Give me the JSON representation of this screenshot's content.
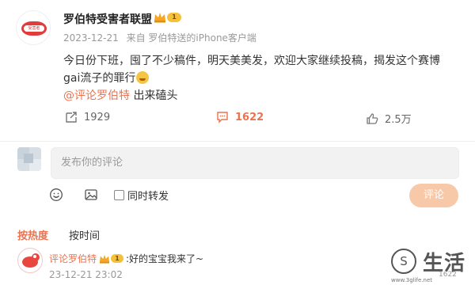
{
  "post": {
    "author": "罗伯特受害者联盟",
    "vip_level": "1",
    "avatar_text": "受害者",
    "time": "2023-12-21",
    "source_prefix": "来自",
    "source": "罗伯特送的iPhone客户端",
    "content": "今日份下班，囤了不少稿件，明天美美发，欢迎大家继续投稿，揭发这个赛博gai流子的罪行",
    "mention": "@评论罗伯特",
    "mention_suffix": " 出来磕头",
    "reposts": "1929",
    "comments": "1622",
    "likes": "2.5万"
  },
  "comment_box": {
    "placeholder": "发布你的评论",
    "forward_label": "同时转发",
    "submit_label": "评论"
  },
  "sort_tabs": [
    {
      "label": "按热度",
      "active": true
    },
    {
      "label": "按时间",
      "active": false
    }
  ],
  "reply": {
    "author": "评论罗伯特",
    "vip_level": "1",
    "text": ":好的宝宝我来了~",
    "time": "23-12-21 23:02"
  },
  "watermark": {
    "logo_text": "S",
    "name": "生活",
    "url": "www.3glife.net",
    "count": "1622"
  },
  "colors": {
    "accent": "#eb7350",
    "vip_badge": "#f6c13a",
    "submit_disabled": "#f8c9a8"
  }
}
